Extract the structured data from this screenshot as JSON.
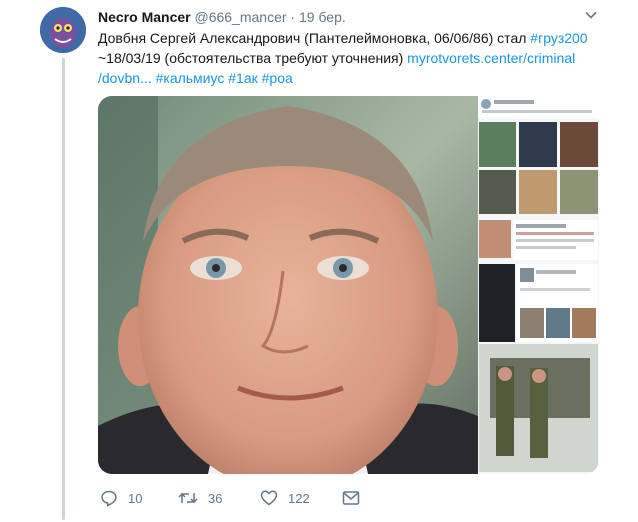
{
  "tweet": {
    "author_name": "Necro Mancer",
    "handle": "@666_mancer",
    "separator": "·",
    "time": "19 бер.",
    "text_plain_1": "Довбня Сергей Александрович (Пантелеймоновка, 06/06/86) стал ",
    "hashtag_gruz": "#груз200",
    "text_plain_2": "~18/03/19 (обстоятельства требуют уточнения) ",
    "link_part1": "myrotvorets.center/criminal",
    "link_part2": "/dovbn...",
    "hashtag_kalmius": "#кальмиус",
    "hashtag_1ak": "#1ак",
    "hashtag_roa": "#роа"
  },
  "actions": {
    "reply_count": "10",
    "retweet_count": "36",
    "like_count": "122"
  },
  "icons": {
    "caret": "chevron-down-icon",
    "reply": "reply-icon",
    "retweet": "retweet-icon",
    "like": "heart-icon",
    "dm": "envelope-icon"
  },
  "colors": {
    "link": "#1b95e0",
    "muted": "#657786",
    "thread_line": "#cdd6dd"
  }
}
